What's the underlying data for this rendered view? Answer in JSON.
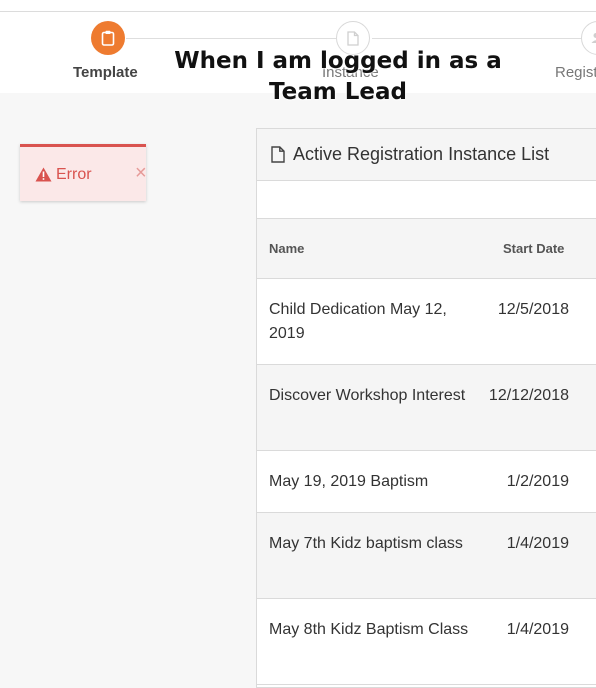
{
  "wizard": {
    "steps": [
      {
        "label": "Template",
        "icon": "clipboard-icon",
        "state": "active"
      },
      {
        "label": "Instance",
        "icon": "file-icon",
        "state": "inactive"
      },
      {
        "label": "Regist",
        "icon": "users-icon",
        "state": "inactive"
      }
    ],
    "active_color": "#ee7b30"
  },
  "overlay_caption": {
    "line1": "When I am logged in as a",
    "line2": "Team Lead"
  },
  "error_alert": {
    "icon": "warning-icon",
    "text": "Error",
    "close_glyph": "×",
    "color": "#d9534f"
  },
  "panel": {
    "icon": "file-icon",
    "title": "Active Registration Instance List",
    "columns": {
      "name": "Name",
      "start_date": "Start Date"
    },
    "rows": [
      {
        "name": "Child Dedication May 12, 2019",
        "start_date": "12/5/2018"
      },
      {
        "name": "Discover Workshop Interest",
        "start_date": "12/12/2018"
      },
      {
        "name": "May 19, 2019 Baptism",
        "start_date": "1/2/2019"
      },
      {
        "name": "May 7th Kidz baptism class",
        "start_date": "1/4/2019"
      },
      {
        "name": "May 8th Kidz Baptism Class",
        "start_date": "1/4/2019"
      }
    ]
  }
}
